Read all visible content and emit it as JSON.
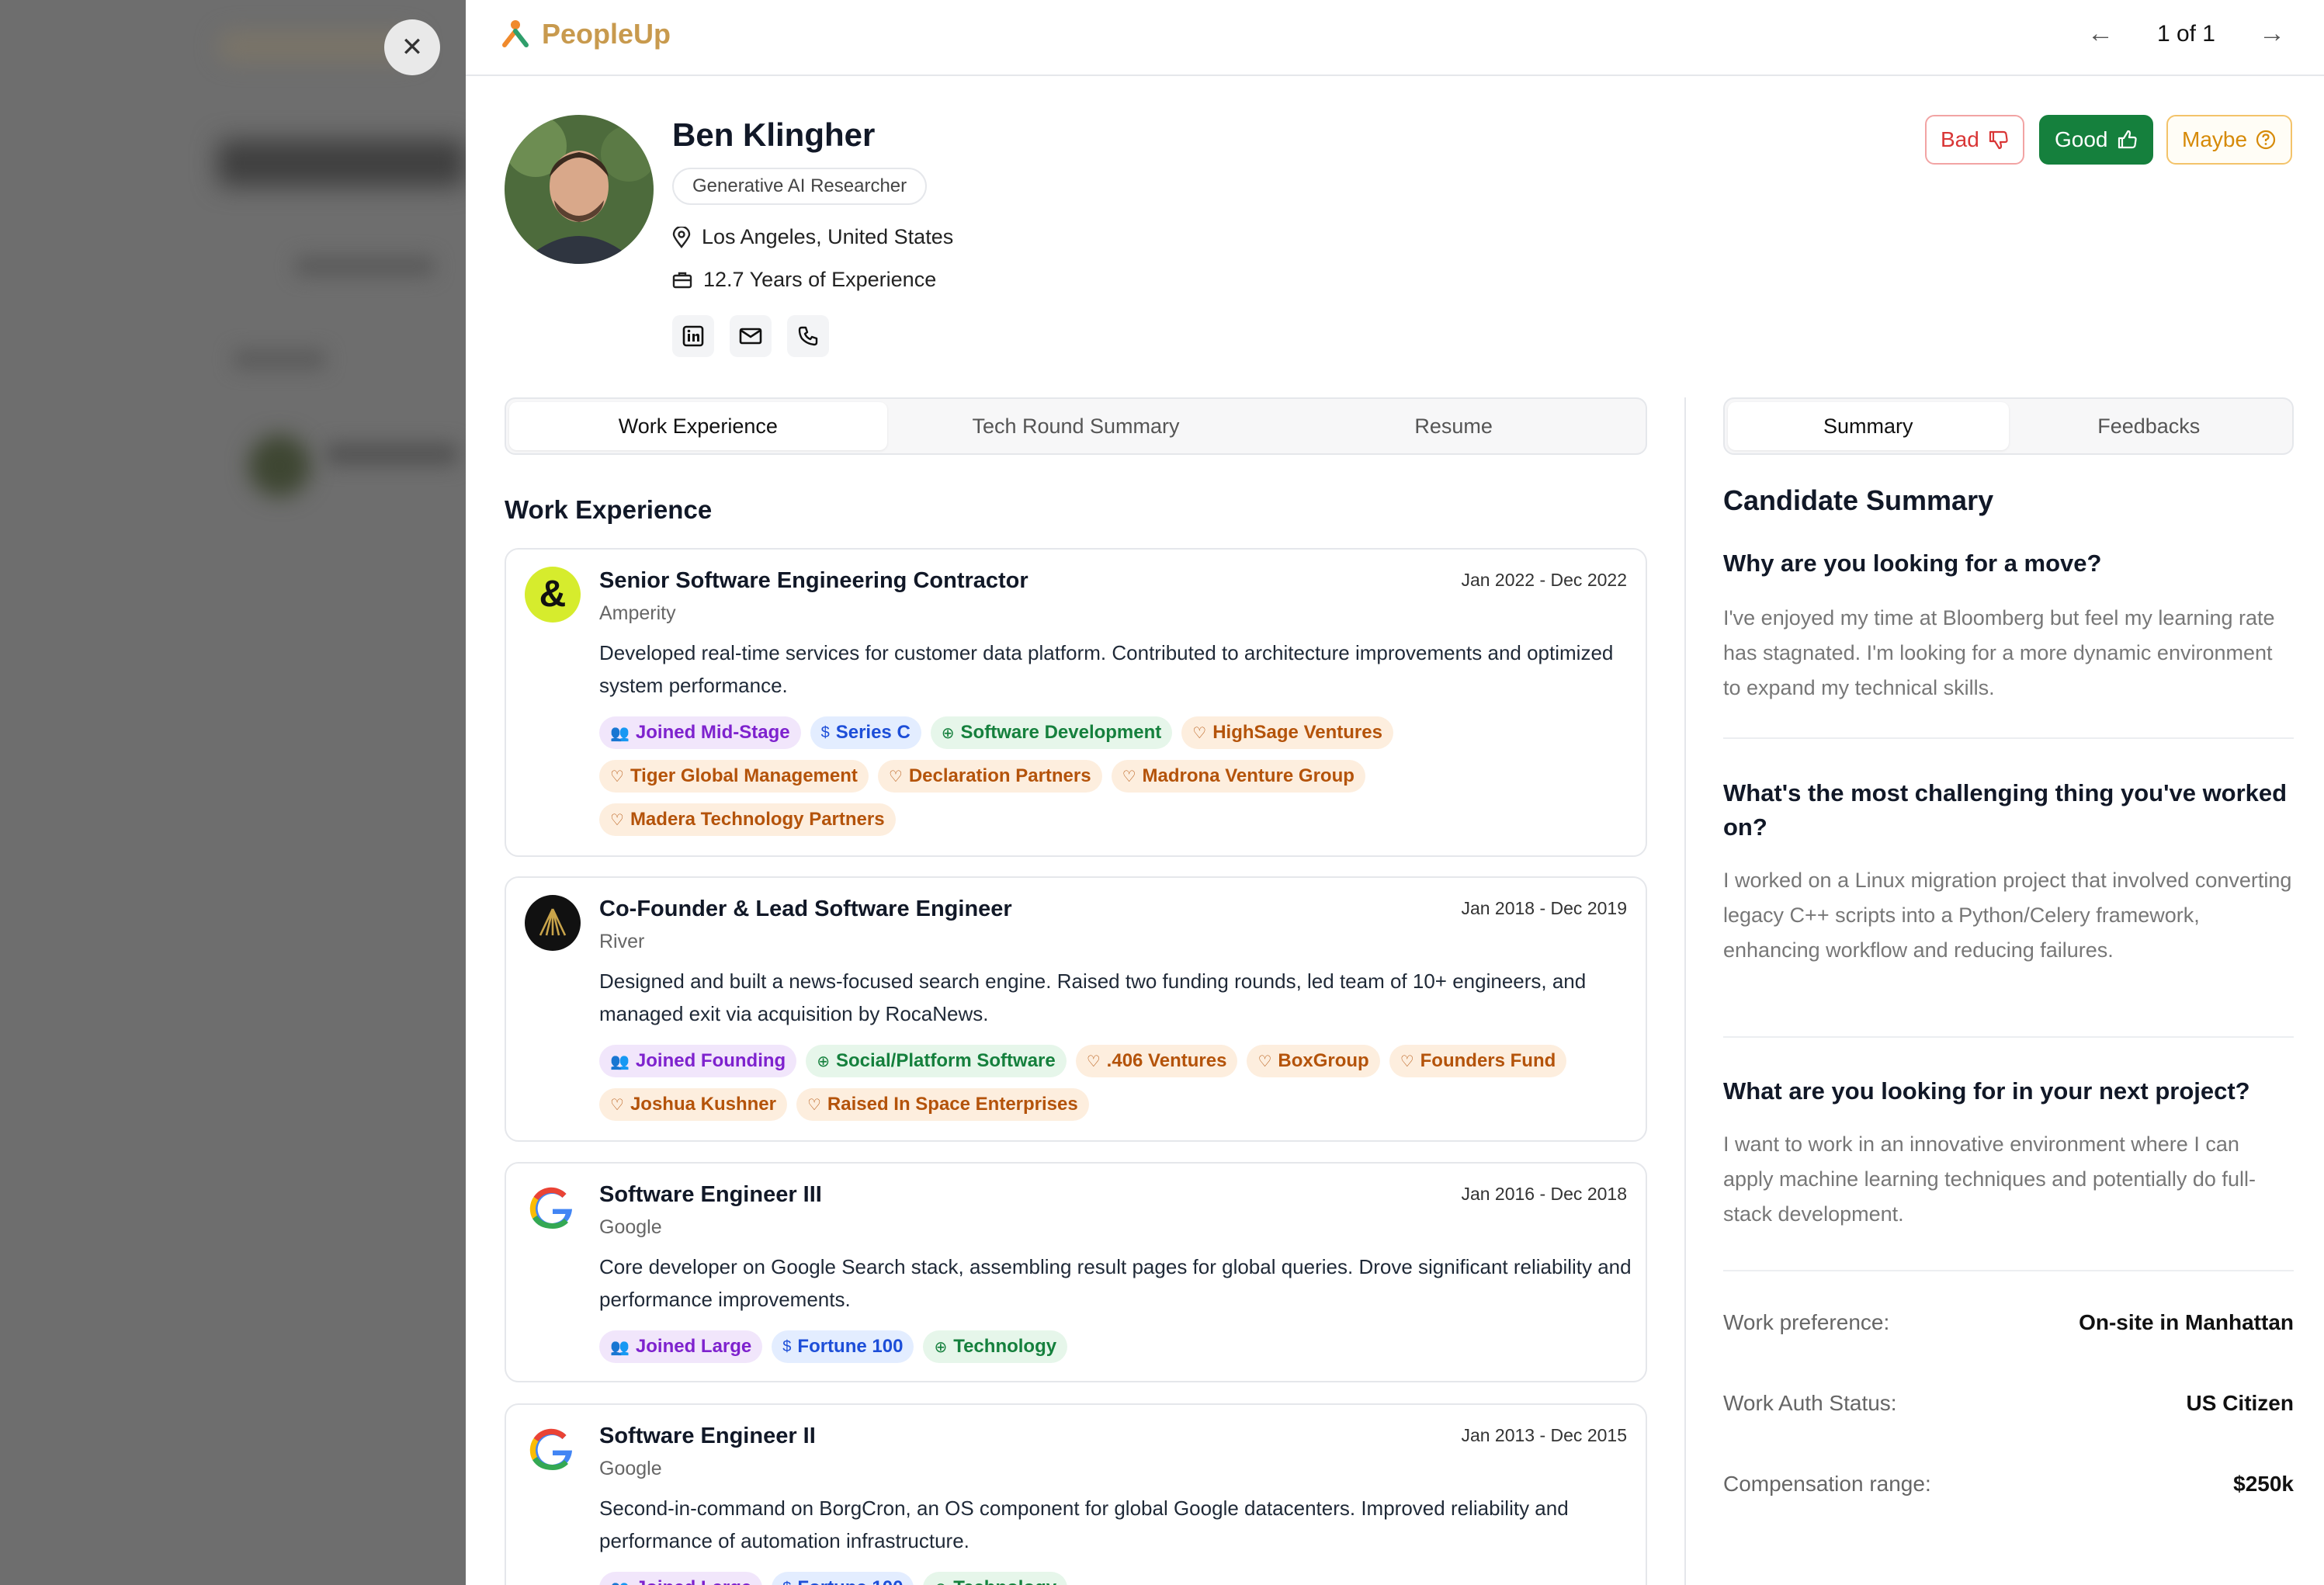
{
  "app": {
    "brand": "PeopleUp",
    "pager": "1 of 1"
  },
  "candidate": {
    "name": "Ben Klingher",
    "role": "Generative AI Researcher",
    "location": "Los Angeles, United States",
    "experience": "12.7 Years of Experience"
  },
  "verdicts": {
    "bad": "Bad",
    "good": "Good",
    "maybe": "Maybe"
  },
  "left_tabs": [
    "Work Experience",
    "Tech Round Summary",
    "Resume"
  ],
  "right_tabs": [
    "Summary",
    "Feedbacks"
  ],
  "work_section_title": "Work Experience",
  "jobs": [
    {
      "title": "Senior Software Engineering Contractor",
      "company": "Amperity",
      "dates": "Jan 2022 - Dec 2022",
      "desc": "Developed real-time services for customer data platform. Contributed to architecture improvements and optimized system performance.",
      "tags": [
        {
          "label": "Joined Mid-Stage",
          "kind": "purple"
        },
        {
          "label": "Series C",
          "kind": "blue"
        },
        {
          "label": "Software Development",
          "kind": "green"
        },
        {
          "label": "HighSage Ventures",
          "kind": "orange"
        },
        {
          "label": "Tiger Global Management",
          "kind": "orange"
        },
        {
          "label": "Declaration Partners",
          "kind": "orange"
        },
        {
          "label": "Madrona Venture Group",
          "kind": "orange"
        },
        {
          "label": "Madera Technology Partners",
          "kind": "orange"
        }
      ]
    },
    {
      "title": "Co-Founder & Lead Software Engineer",
      "company": "River",
      "dates": "Jan 2018 - Dec 2019",
      "desc": "Designed and built a news-focused search engine. Raised two funding rounds, led team of 10+ engineers, and managed exit via acquisition by RocaNews.",
      "tags": [
        {
          "label": "Joined Founding",
          "kind": "purple"
        },
        {
          "label": "Social/Platform Software",
          "kind": "green"
        },
        {
          "label": ".406 Ventures",
          "kind": "orange"
        },
        {
          "label": "BoxGroup",
          "kind": "orange"
        },
        {
          "label": "Founders Fund",
          "kind": "orange"
        },
        {
          "label": "Joshua Kushner",
          "kind": "orange"
        },
        {
          "label": "Raised In Space Enterprises",
          "kind": "orange"
        }
      ]
    },
    {
      "title": "Software Engineer III",
      "company": "Google",
      "dates": "Jan 2016 - Dec 2018",
      "desc": "Core developer on Google Search stack, assembling result pages for global queries. Drove significant reliability and performance improvements.",
      "tags": [
        {
          "label": "Joined Large",
          "kind": "purple"
        },
        {
          "label": "Fortune 100",
          "kind": "blue"
        },
        {
          "label": "Technology",
          "kind": "green"
        }
      ]
    },
    {
      "title": "Software Engineer II",
      "company": "Google",
      "dates": "Jan 2013 - Dec 2015",
      "desc": "Second-in-command on BorgCron, an OS component for global Google datacenters. Improved reliability and performance of automation infrastructure.",
      "tags": [
        {
          "label": "Joined Large",
          "kind": "purple"
        },
        {
          "label": "Fortune 100",
          "kind": "blue"
        },
        {
          "label": "Technology",
          "kind": "green"
        }
      ]
    }
  ],
  "summary": {
    "title": "Candidate Summary",
    "qa": [
      {
        "q": "Why are you looking for a move?",
        "a": "I've enjoyed my time at Bloomberg but feel my learning rate has stagnated. I'm looking for a more dynamic environment to expand my technical skills."
      },
      {
        "q": "What's the most challenging thing you've worked on?",
        "a": "I worked on a Linux migration project that involved converting legacy C++ scripts into a Python/Celery framework, enhancing workflow and reducing failures."
      },
      {
        "q": "What are you looking for in your next project?",
        "a": "I want to work in an innovative environment where I can apply machine learning techniques and potentially do full-stack development."
      }
    ],
    "facts": [
      {
        "k": "Work preference:",
        "v": "On-site in Manhattan"
      },
      {
        "k": "Work Auth Status:",
        "v": "US Citizen"
      },
      {
        "k": "Compensation range:",
        "v": "$250k"
      }
    ]
  }
}
